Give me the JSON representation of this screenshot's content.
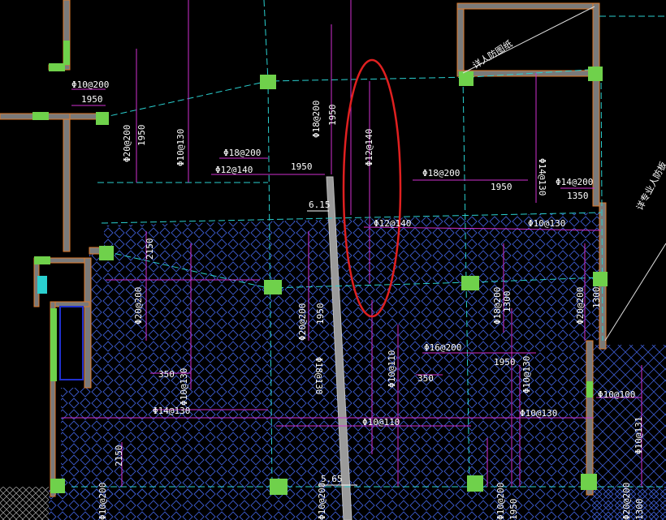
{
  "drawing": {
    "colors": {
      "background": "#000000",
      "rebar_line": "#d02fd0",
      "axis_line": "#2ad0d0",
      "column": "#6fd14b",
      "wall": "#8a8a8a",
      "hatch": "#3a58c8",
      "text": "#ffffff",
      "highlight": "#e02020",
      "wall_edge": "#e07a2a"
    },
    "notes": {
      "elevation_upper": "6.15",
      "elevation_lower": "5.65",
      "room_label": "详人防图纸",
      "right_note": "详专业人防板"
    },
    "labels": {
      "l01": "Φ10@200",
      "l02": "1950",
      "l03": "Φ20@200",
      "l04": "1950",
      "l05": "Φ10@130",
      "l06": "Φ18@200",
      "l07": "Φ12@140",
      "l08": "1950",
      "l09": "Φ18@200",
      "l10": "1950",
      "l11": "Φ12@140",
      "l12": "Φ18@200",
      "l13": "1950",
      "l14": "Φ14@130",
      "l15": "Φ14@200",
      "l16": "1350",
      "l17": "Φ12@140",
      "l18": "Φ10@130",
      "l19": "2150",
      "l20": "Φ20@200",
      "l21": "Φ20@200",
      "l22": "1950",
      "l23": "Φ18@130",
      "l24": "Φ16@200",
      "l25": "Φ10@110",
      "l26": "350",
      "l27": "1950",
      "l28": "Φ10@130",
      "l29": "Φ18@200",
      "l30": "1300",
      "l31": "Φ20@200",
      "l32": "1300",
      "l33": "350",
      "l34": "Φ10@130",
      "l35": "Φ14@130",
      "l36": "Φ10@110",
      "l37": "Φ10@130",
      "l38": "Φ10@100",
      "l39": "2150",
      "l40": "Φ10@131",
      "l41": "Φ10@200",
      "l42": "Φ10@200",
      "l43": "Φ10@200",
      "l44": "1950",
      "l45": "Φ20@200",
      "l46": "1300"
    }
  }
}
